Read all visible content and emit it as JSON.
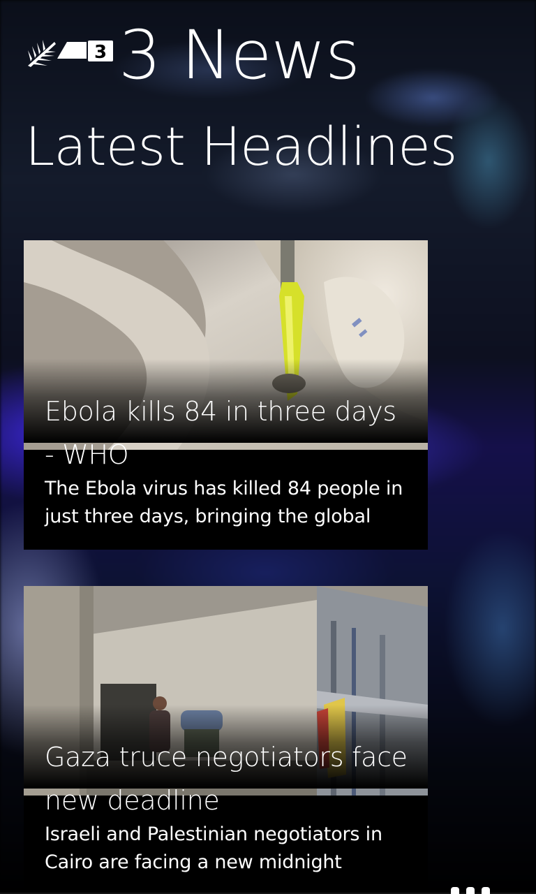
{
  "app": {
    "title": "3 News",
    "logo_icon": "tv3-logo-icon"
  },
  "page": {
    "title": "Latest Headlines"
  },
  "articles": [
    {
      "headline": "Ebola kills 84 in three days - WHO",
      "summary": "The Ebola virus has killed 84 people in just three days, bringing the global",
      "image_icon": "hazmat-suit-photo"
    },
    {
      "headline": "Gaza truce negotiators face new deadline",
      "summary": "Israeli and Palestinian negotiators in Cairo are facing a new midnight",
      "image_icon": "street-scene-photo"
    }
  ],
  "appbar": {
    "more_icon": "ellipsis-icon"
  },
  "colors": {
    "tile_background": "#000000",
    "text": "#ffffff",
    "background_accent": "#4a3ee6"
  }
}
